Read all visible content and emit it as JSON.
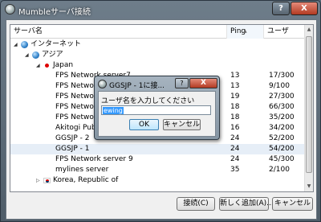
{
  "window": {
    "title": "Mumbleサーバ接続",
    "help_label": "?",
    "close_label": "X"
  },
  "list": {
    "headers": {
      "name": "サーバ名",
      "ping": "Ping",
      "users": "ユーザ"
    },
    "rows": [
      {
        "name": "インターネット",
        "ping": "",
        "users": "",
        "kind": "folder",
        "level": 0,
        "expanded": true
      },
      {
        "name": "アジア",
        "ping": "",
        "users": "",
        "kind": "folder",
        "level": 1,
        "expanded": true
      },
      {
        "name": "Japan",
        "ping": "",
        "users": "",
        "kind": "country",
        "level": 2,
        "expanded": true
      },
      {
        "name": "FPS Network server7",
        "ping": "13",
        "users": "17/300",
        "kind": "server",
        "level": 3
      },
      {
        "name": "FPS Network",
        "ping": "13",
        "users": "9/100",
        "kind": "server",
        "level": 3
      },
      {
        "name": "FPS Network",
        "ping": "19",
        "users": "27/300",
        "kind": "server",
        "level": 3
      },
      {
        "name": "FPS Network",
        "ping": "18",
        "users": "66/300",
        "kind": "server",
        "level": 3
      },
      {
        "name": "FPS Network",
        "ping": "18",
        "users": "35/200",
        "kind": "server",
        "level": 3
      },
      {
        "name": "Akitogi Public",
        "ping": "16",
        "users": "34/200",
        "kind": "server",
        "level": 3
      },
      {
        "name": "GGSJP - 2",
        "ping": "24",
        "users": "52/200",
        "kind": "server",
        "level": 3
      },
      {
        "name": "GGSJP - 1",
        "ping": "24",
        "users": "54/200",
        "kind": "server",
        "level": 3,
        "selected": true
      },
      {
        "name": "FPS Network server 9",
        "ping": "24",
        "users": "45/300",
        "kind": "server",
        "level": 3
      },
      {
        "name": "mylines server",
        "ping": "35",
        "users": "2/100",
        "kind": "server",
        "level": 3
      },
      {
        "name": "Korea, Republic of",
        "ping": "",
        "users": "",
        "kind": "country-kr",
        "level": 2,
        "expanded": false
      }
    ]
  },
  "buttons": {
    "connect": "接続(C)",
    "add": "新しく追加(A)...",
    "cancel": "キャンセル"
  },
  "dialog": {
    "title": "GGSJP - 1に接...",
    "help_label": "?",
    "close_label": "X",
    "prompt": "ユーザ名を入力してください",
    "input_value": "ewing",
    "ok": "OK",
    "cancel": "キャンセル"
  }
}
